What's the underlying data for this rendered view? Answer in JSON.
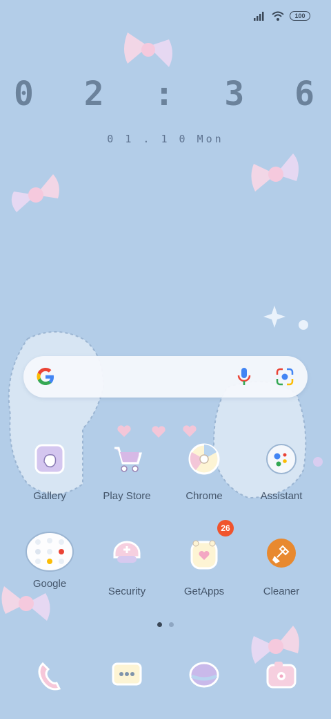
{
  "status": {
    "battery": "100"
  },
  "clock": {
    "time": "0 2 : 3 6",
    "date": "0 1 . 1 0  Mon"
  },
  "search": {
    "google_icon": "google-g-icon",
    "mic_icon": "mic-icon",
    "lens_icon": "lens-icon"
  },
  "apps_row1": [
    {
      "label": "Gallery",
      "icon": "gallery-icon"
    },
    {
      "label": "Play Store",
      "icon": "play-store-icon"
    },
    {
      "label": "Chrome",
      "icon": "chrome-icon"
    },
    {
      "label": "Assistant",
      "icon": "assistant-icon"
    }
  ],
  "apps_row2": [
    {
      "label": "Google",
      "icon": "google-folder-icon"
    },
    {
      "label": "Security",
      "icon": "security-icon"
    },
    {
      "label": "GetApps",
      "icon": "getapps-icon",
      "badge": "26"
    },
    {
      "label": "Cleaner",
      "icon": "cleaner-icon"
    }
  ],
  "dock": [
    {
      "icon": "phone-icon"
    },
    {
      "icon": "messages-icon"
    },
    {
      "icon": "browser-icon"
    },
    {
      "icon": "camera-icon"
    }
  ],
  "page_indicator": {
    "pages": 2,
    "current": 1
  },
  "colors": {
    "background": "#b3cde8",
    "badge": "#f0542d",
    "text": "#44556a"
  }
}
